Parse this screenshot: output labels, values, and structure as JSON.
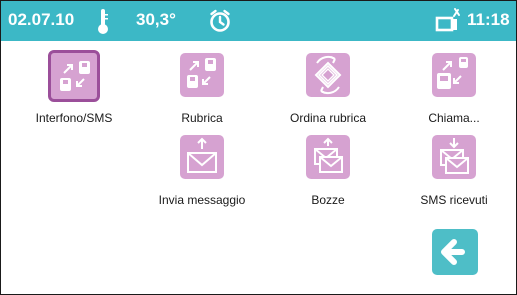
{
  "status": {
    "date": "02.07.10",
    "temperature": "30,3°",
    "time": "11:18"
  },
  "tiles": [
    {
      "label": "Interfono/SMS",
      "icon": "interphone-sms-icon",
      "selected": true
    },
    {
      "label": "Rubrica",
      "icon": "phonebook-icon"
    },
    {
      "label": "Ordina rubrica",
      "icon": "sort-phonebook-icon"
    },
    {
      "label": "Chiama...",
      "icon": "call-icon"
    },
    {
      "label": "Invia messaggio",
      "icon": "send-message-icon"
    },
    {
      "label": "Bozze",
      "icon": "drafts-icon"
    },
    {
      "label": "SMS ricevuti",
      "icon": "received-sms-icon"
    }
  ],
  "back": {
    "icon": "back-arrow-icon"
  },
  "colors": {
    "statusbar": "#3cb8c6",
    "tile": "#d6a2d1",
    "selected_border": "#9b4f9a",
    "back_button": "#4ebec7"
  }
}
